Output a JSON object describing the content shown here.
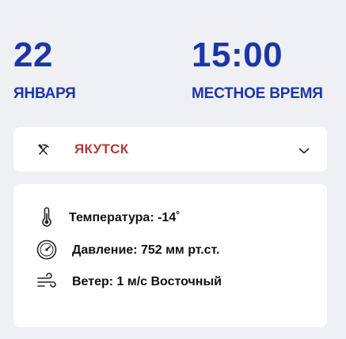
{
  "date": {
    "day": "22",
    "month": "ЯНВАРЯ"
  },
  "time": {
    "value": "15:00",
    "label": "МЕСТНОЕ ВРЕМЯ"
  },
  "city_select": {
    "icon": "pickaxe-hammer-icon",
    "selected": "ЯКУТСК",
    "chevron_icon": "chevron-down-icon"
  },
  "weather": {
    "temperature": {
      "icon": "thermometer-icon",
      "text": "Температура: -14˚"
    },
    "pressure": {
      "icon": "barometer-icon",
      "text": "Давление: 752 мм рт.ст."
    },
    "wind": {
      "icon": "wind-icon",
      "text": "Ветер: 1 м/с Восточный"
    }
  },
  "colors": {
    "accent": "#1e35a8",
    "city": "#b03a3a",
    "background": "#eef0f4",
    "card": "#ffffff"
  }
}
